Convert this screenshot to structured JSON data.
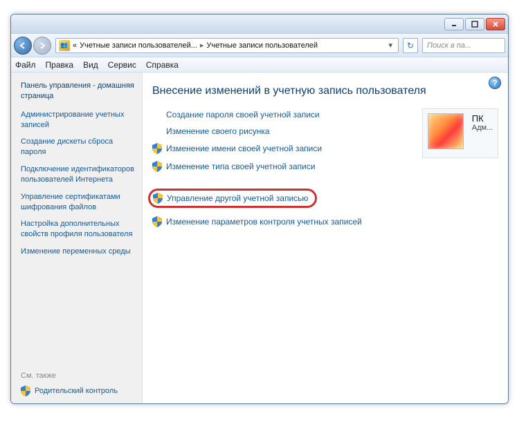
{
  "breadcrumb": {
    "prefix": "«",
    "part1": "Учетные записи пользователей...",
    "part2": "Учетные записи пользователей"
  },
  "search": {
    "placeholder": "Поиск в па..."
  },
  "menu": {
    "file": "Файл",
    "edit": "Правка",
    "view": "Вид",
    "service": "Сервис",
    "help": "Справка"
  },
  "sidebar": {
    "home": "Панель управления - домашняя страница",
    "items": [
      "Администрирование учетных записей",
      "Создание дискеты сброса пароля",
      "Подключение идентификаторов пользователей Интернета",
      "Управление сертификатами шифрования файлов",
      "Настройка дополнительных свойств профиля пользователя",
      "Изменение переменных среды"
    ],
    "see_also_label": "См. также",
    "parental": "Родительский контроль"
  },
  "main": {
    "title": "Внесение изменений в учетную запись пользователя",
    "links_plain": [
      "Создание пароля своей учетной записи",
      "Изменение своего рисунка"
    ],
    "links_shield": [
      "Изменение имени своей учетной записи",
      "Изменение типа своей учетной записи"
    ],
    "link_highlight": "Управление другой учетной записью",
    "link_uac": "Изменение параметров контроля учетных записей"
  },
  "user": {
    "name": "ПК",
    "role": "Адм..."
  }
}
